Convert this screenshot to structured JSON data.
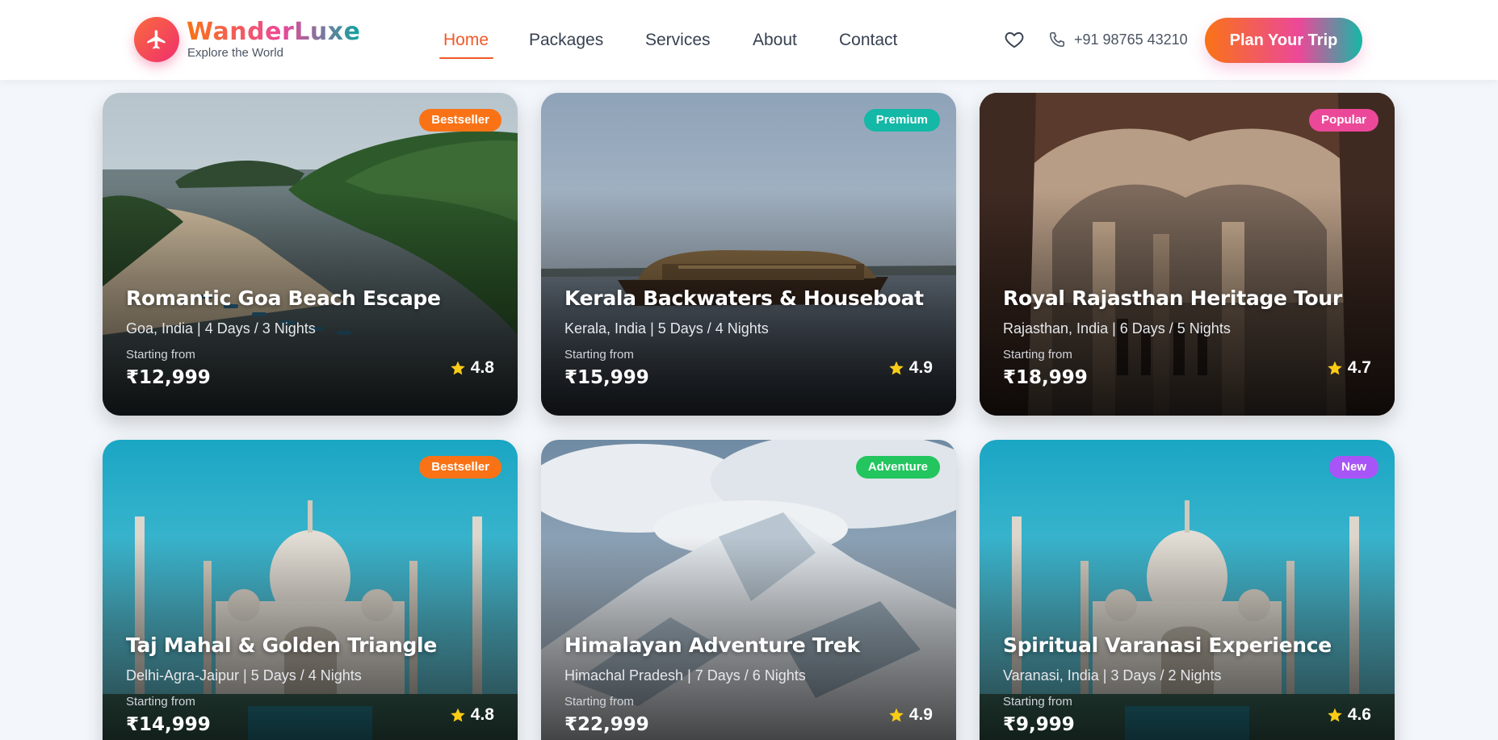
{
  "brand": {
    "name": "WanderLuxe",
    "tagline": "Explore the World"
  },
  "nav": [
    {
      "label": "Home",
      "active": true
    },
    {
      "label": "Packages",
      "active": false
    },
    {
      "label": "Services",
      "active": false
    },
    {
      "label": "About",
      "active": false
    },
    {
      "label": "Contact",
      "active": false
    }
  ],
  "header": {
    "phone": "+91 98765 43210",
    "cta_label": "Plan Your Trip"
  },
  "icons": {
    "logo": "airplane-icon",
    "wishlist": "heart-icon",
    "phone": "phone-icon",
    "rating": "star-icon"
  },
  "colors": {
    "accent": "#f05a28",
    "badge_bestseller": "#f97316",
    "badge_premium": "#14b8a6",
    "badge_popular": "#ec4899",
    "badge_adventure": "#22c55e",
    "badge_new": "#a855f7",
    "star": "#facc15"
  },
  "packages": [
    {
      "badge": "Bestseller",
      "title": "Romantic Goa Beach Escape",
      "subtitle": "Goa, India | 4 Days / 3 Nights",
      "from_label": "Starting from",
      "price": "₹12,999",
      "rating": "4.8"
    },
    {
      "badge": "Premium",
      "title": "Kerala Backwaters & Houseboat",
      "subtitle": "Kerala, India | 5 Days / 4 Nights",
      "from_label": "Starting from",
      "price": "₹15,999",
      "rating": "4.9"
    },
    {
      "badge": "Popular",
      "title": "Royal Rajasthan Heritage Tour",
      "subtitle": "Rajasthan, India | 6 Days / 5 Nights",
      "from_label": "Starting from",
      "price": "₹18,999",
      "rating": "4.7"
    },
    {
      "badge": "Bestseller",
      "title": "Taj Mahal & Golden Triangle",
      "subtitle": "Delhi-Agra-Jaipur | 5 Days / 4 Nights",
      "from_label": "Starting from",
      "price": "₹14,999",
      "rating": "4.8"
    },
    {
      "badge": "Adventure",
      "title": "Himalayan Adventure Trek",
      "subtitle": "Himachal Pradesh | 7 Days / 6 Nights",
      "from_label": "Starting from",
      "price": "₹22,999",
      "rating": "4.9"
    },
    {
      "badge": "New",
      "title": "Spiritual Varanasi Experience",
      "subtitle": "Varanasi, India | 3 Days / 2 Nights",
      "from_label": "Starting from",
      "price": "₹9,999",
      "rating": "4.6"
    }
  ]
}
